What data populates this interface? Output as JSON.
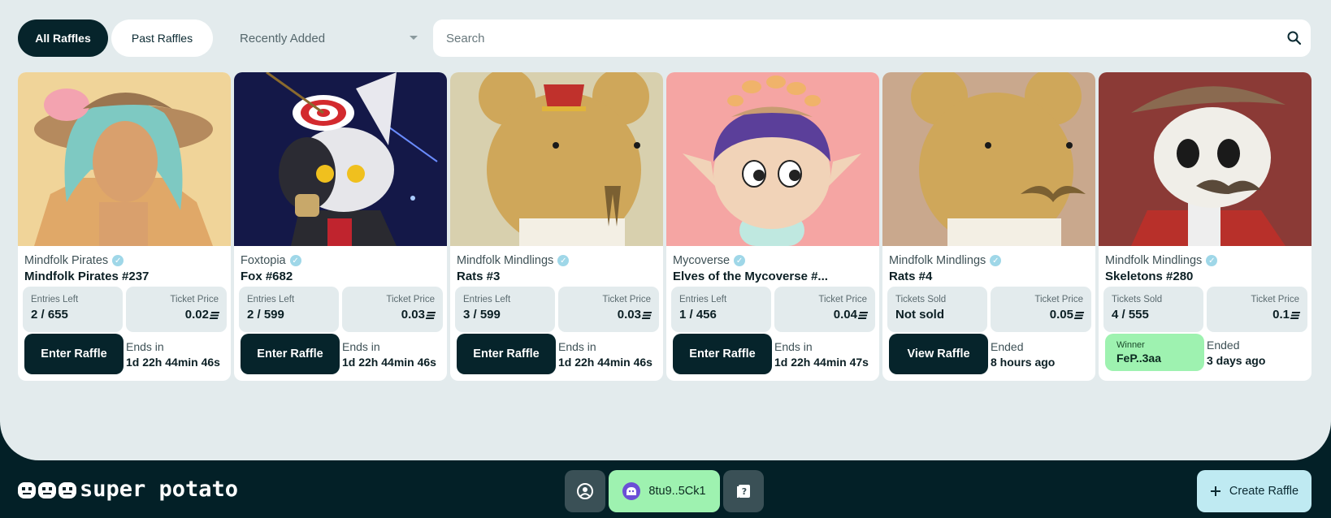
{
  "filters": {
    "all_label": "All Raffles",
    "past_label": "Past Raffles",
    "sort_label": "Recently Added",
    "search_placeholder": "Search"
  },
  "cards": [
    {
      "collection": "Mindfolk Pirates",
      "name": "Mindfolk Pirates #237",
      "stat1_label": "Entries Left",
      "stat1_value": "2 / 655",
      "price_label": "Ticket Price",
      "price": "0.02",
      "button": "Enter Raffle",
      "time_label": "Ends in",
      "time_value": "1d 22h 44min 46s"
    },
    {
      "collection": "Foxtopia",
      "name": "Fox #682",
      "stat1_label": "Entries Left",
      "stat1_value": "2 / 599",
      "price_label": "Ticket Price",
      "price": "0.03",
      "button": "Enter Raffle",
      "time_label": "Ends in",
      "time_value": "1d 22h 44min 46s"
    },
    {
      "collection": "Mindfolk Mindlings",
      "name": "Rats #3",
      "stat1_label": "Entries Left",
      "stat1_value": "3 / 599",
      "price_label": "Ticket Price",
      "price": "0.03",
      "button": "Enter Raffle",
      "time_label": "Ends in",
      "time_value": "1d 22h 44min 46s"
    },
    {
      "collection": "Mycoverse",
      "name": "Elves of the Mycoverse #...",
      "stat1_label": "Entries Left",
      "stat1_value": "1 / 456",
      "price_label": "Ticket Price",
      "price": "0.04",
      "button": "Enter Raffle",
      "time_label": "Ends in",
      "time_value": "1d 22h 44min 47s"
    },
    {
      "collection": "Mindfolk Mindlings",
      "name": "Rats #4",
      "stat1_label": "Tickets Sold",
      "stat1_value": "Not sold",
      "price_label": "Ticket Price",
      "price": "0.05",
      "button": "View Raffle",
      "time_label": "Ended",
      "time_value": "8 hours ago"
    },
    {
      "collection": "Mindfolk Mindlings",
      "name": "Skeletons #280",
      "stat1_label": "Tickets Sold",
      "stat1_value": "4 / 555",
      "price_label": "Ticket Price",
      "price": "0.1",
      "winner_label": "Winner",
      "winner_value": "FeP..3aa",
      "time_label": "Ended",
      "time_value": "3 days ago"
    }
  ],
  "footer": {
    "logo_text": "super potato",
    "wallet": "8tu9..5Ck1",
    "create_label": "Create Raffle"
  },
  "colors": {
    "primary_dark": "#06242b",
    "background": "#e3ebed",
    "footer_bg": "#032027",
    "wallet_green": "#9ef2b0",
    "create_blue": "#bfeaf2"
  },
  "icons": {
    "search": "search-icon",
    "verified": "verified-badge-icon",
    "user": "user-circle-icon",
    "help": "help-icon",
    "plus": "plus-icon",
    "currency": "solana-icon"
  }
}
